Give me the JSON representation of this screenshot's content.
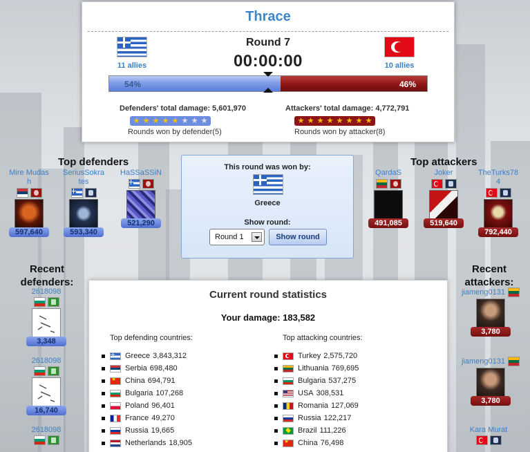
{
  "battle": {
    "region": "Thrace",
    "round_label": "Round 7",
    "timer": "00:00:00",
    "defender_allies": "11 allies",
    "attacker_allies": "10 allies",
    "defender_country": "Greece",
    "attacker_country": "Turkey",
    "defender_pct_label": "54%",
    "attacker_pct_label": "46%",
    "defender_pct": 54,
    "defender_damage": "Defenders' total damage: 5,601,970",
    "attacker_damage": "Attackers' total damage: 4,772,791",
    "defender_rounds_won": 5,
    "attacker_rounds_won": 8,
    "rounds_total_stars": 8,
    "defender_rounds_text": "Rounds won by defender(5)",
    "attacker_rounds_text": "Rounds won by attacker(8)"
  },
  "top_defenders": {
    "title": "Top defenders",
    "players": [
      {
        "name": "Mire Mudash",
        "damage": "597,640",
        "country": "Serbia"
      },
      {
        "name": "SeriusSokrates",
        "damage": "593,340",
        "country": "Greece"
      },
      {
        "name": "HaSSaSSiN",
        "damage": "521,290",
        "country": "Greece"
      }
    ]
  },
  "top_attackers": {
    "title": "Top attackers",
    "players": [
      {
        "name": "QardaS",
        "damage": "491,085",
        "country": "Lithuania"
      },
      {
        "name": "Joker",
        "damage": "519,640",
        "country": "Turkey"
      },
      {
        "name": "TheTurks784",
        "damage": "792,440",
        "country": "Turkey"
      }
    ]
  },
  "round_box": {
    "won_label": "This round was won by:",
    "winner": "Greece",
    "show_label": "Show round:",
    "selected_round": "Round 1",
    "show_button": "Show round"
  },
  "stats": {
    "title": "Current round statistics",
    "your_damage": "Your damage: 183,582",
    "def_title": "Top defending countries:",
    "att_title": "Top attacking countries:",
    "defending": [
      {
        "country": "Greece",
        "value": "3,843,312"
      },
      {
        "country": "Serbia",
        "value": "698,480"
      },
      {
        "country": "China",
        "value": "694,791"
      },
      {
        "country": "Bulgaria",
        "value": "107,268"
      },
      {
        "country": "Poland",
        "value": "96,401"
      },
      {
        "country": "France",
        "value": "49,270"
      },
      {
        "country": "Russia",
        "value": "19,665"
      },
      {
        "country": "Netherlands",
        "value": "18,905"
      }
    ],
    "attacking": [
      {
        "country": "Turkey",
        "value": "2,575,720"
      },
      {
        "country": "Lithuania",
        "value": "769,695"
      },
      {
        "country": "Bulgaria",
        "value": "537,275"
      },
      {
        "country": "USA",
        "value": "308,531"
      },
      {
        "country": "Romania",
        "value": "127,069"
      },
      {
        "country": "Russia",
        "value": "122,217"
      },
      {
        "country": "Brazil",
        "value": "111,226"
      },
      {
        "country": "China",
        "value": "76,498"
      }
    ]
  },
  "recent_defenders": {
    "title_line1": "Recent",
    "title_line2": "defenders:",
    "entries": [
      {
        "name": "2618098",
        "damage": "3,348"
      },
      {
        "name": "2618098",
        "damage": "16,740"
      },
      {
        "name": "2618098",
        "damage": ""
      }
    ]
  },
  "recent_attackers": {
    "title_line1": "Recent",
    "title_line2": "attackers:",
    "entries": [
      {
        "name": "jiameng0131",
        "damage": "3,780"
      },
      {
        "name": "jiameng0131",
        "damage": "3,780"
      },
      {
        "name": "Kara Murat",
        "damage": ""
      }
    ]
  },
  "colors": {
    "title_blue": "#3d86c9",
    "defender_blue": "#5b7ddb",
    "attacker_red": "#8e1515",
    "star_gold": "#f6c100"
  }
}
